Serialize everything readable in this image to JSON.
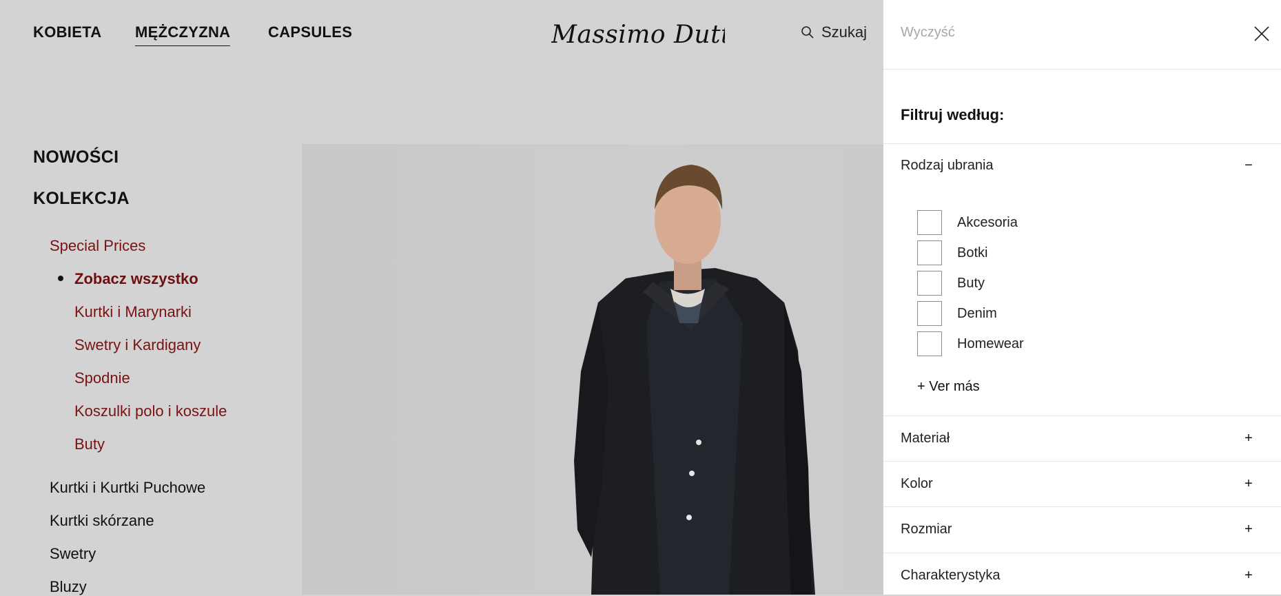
{
  "header": {
    "nav": [
      "KOBIETA",
      "MĘŻCZYZNA",
      "CAPSULES"
    ],
    "logo": "Massimo Dutti",
    "search_label": "Szukaj"
  },
  "sidebar": {
    "top_items": [
      "NOWOŚCI",
      "KOLEKCJA"
    ],
    "special_prices": "Special Prices",
    "special_items": [
      "Zobacz wszystko",
      "Kurtki i Marynarki",
      "Swetry i Kardigany",
      "Spodnie",
      "Koszulki polo i koszule",
      "Buty"
    ],
    "regular_items": [
      "Kurtki i Kurtki Puchowe",
      "Kurtki skórzane",
      "Swetry",
      "Bluzy"
    ]
  },
  "filter_panel": {
    "clear_label": "Wyczyść",
    "title": "Filtruj według:",
    "clothing_type": {
      "label": "Rodzaj ubrania",
      "toggle": "−",
      "options": [
        "Akcesoria",
        "Botki",
        "Buty",
        "Denim",
        "Homewear"
      ],
      "more": "+ Ver más"
    },
    "collapsed_sections": [
      {
        "label": "Materiał",
        "toggle": "+"
      },
      {
        "label": "Kolor",
        "toggle": "+"
      },
      {
        "label": "Rozmiar",
        "toggle": "+"
      },
      {
        "label": "Charakterystyka",
        "toggle": "+"
      }
    ]
  },
  "colors": {
    "accent_red": "#7a1212",
    "backdrop_overlay": "#d3d3d3",
    "panel_bg": "#ffffff"
  }
}
